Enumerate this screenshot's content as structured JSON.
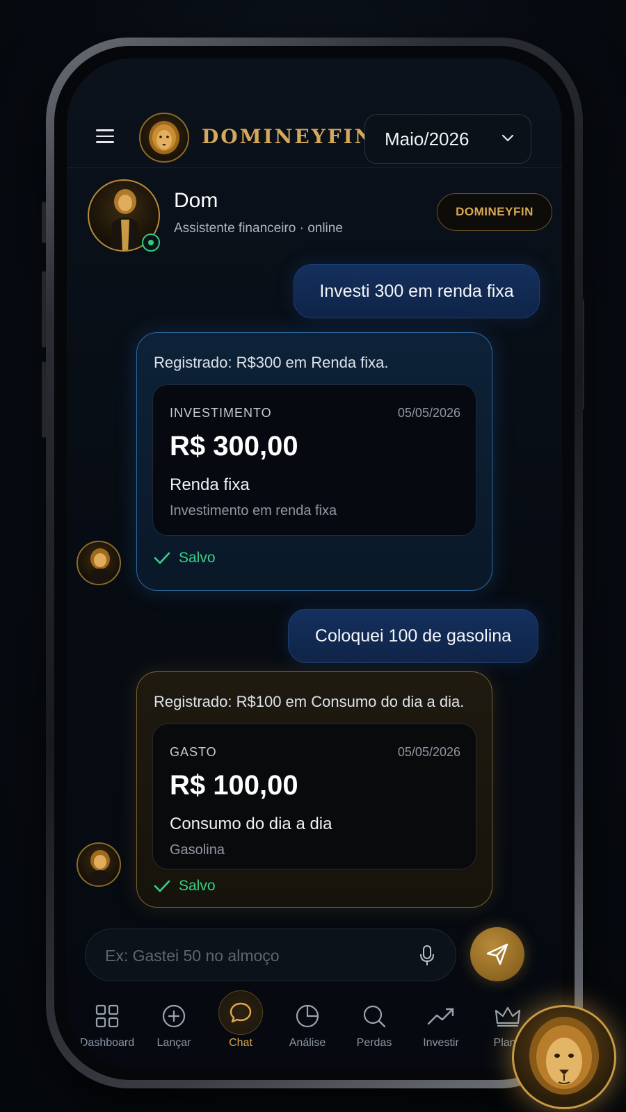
{
  "header": {
    "brand": "DOMINEYFIN",
    "month_selected": "Maio/2026"
  },
  "assistant": {
    "name": "Dom",
    "subtitle": "Assistente financeiro · online",
    "badge": "DOMINEYFIN"
  },
  "messages": [
    {
      "role": "user",
      "text": "Investi 300 em renda fixa"
    },
    {
      "role": "bot",
      "text": "Registrado: R$300 em Renda fixa.",
      "card": {
        "type": "INVESTIMENTO",
        "date": "05/05/2026",
        "amount": "R$ 300,00",
        "category": "Renda fixa",
        "description": "Investimento em renda fixa"
      },
      "status": "Salvo"
    },
    {
      "role": "user",
      "text": "Coloquei 100 de gasolina"
    },
    {
      "role": "bot",
      "text": "Registrado: R$100 em Consumo do dia a dia.",
      "card": {
        "type": "GASTO",
        "date": "05/05/2026",
        "amount": "R$ 100,00",
        "category": "Consumo do dia a dia",
        "description": "Gasolina"
      },
      "status": "Salvo"
    }
  ],
  "input": {
    "placeholder": "Ex: Gastei 50 no almoço",
    "value": ""
  },
  "nav": [
    {
      "label": "Dashboard",
      "icon": "grid-icon"
    },
    {
      "label": "Lançar",
      "icon": "plus-circle-icon"
    },
    {
      "label": "Chat",
      "icon": "chat-bubble-icon",
      "active": true
    },
    {
      "label": "Análise",
      "icon": "pie-chart-icon"
    },
    {
      "label": "Perdas",
      "icon": "search-icon"
    },
    {
      "label": "Investir",
      "icon": "trending-up-icon"
    },
    {
      "label": "Plano",
      "icon": "crown-icon"
    }
  ],
  "colors": {
    "gold_accent": "#d6a85a",
    "user_bubble": "#14305d",
    "success_green": "#35d487",
    "investment_border": "#2e6aa0",
    "expense_border": "#7a6230"
  }
}
